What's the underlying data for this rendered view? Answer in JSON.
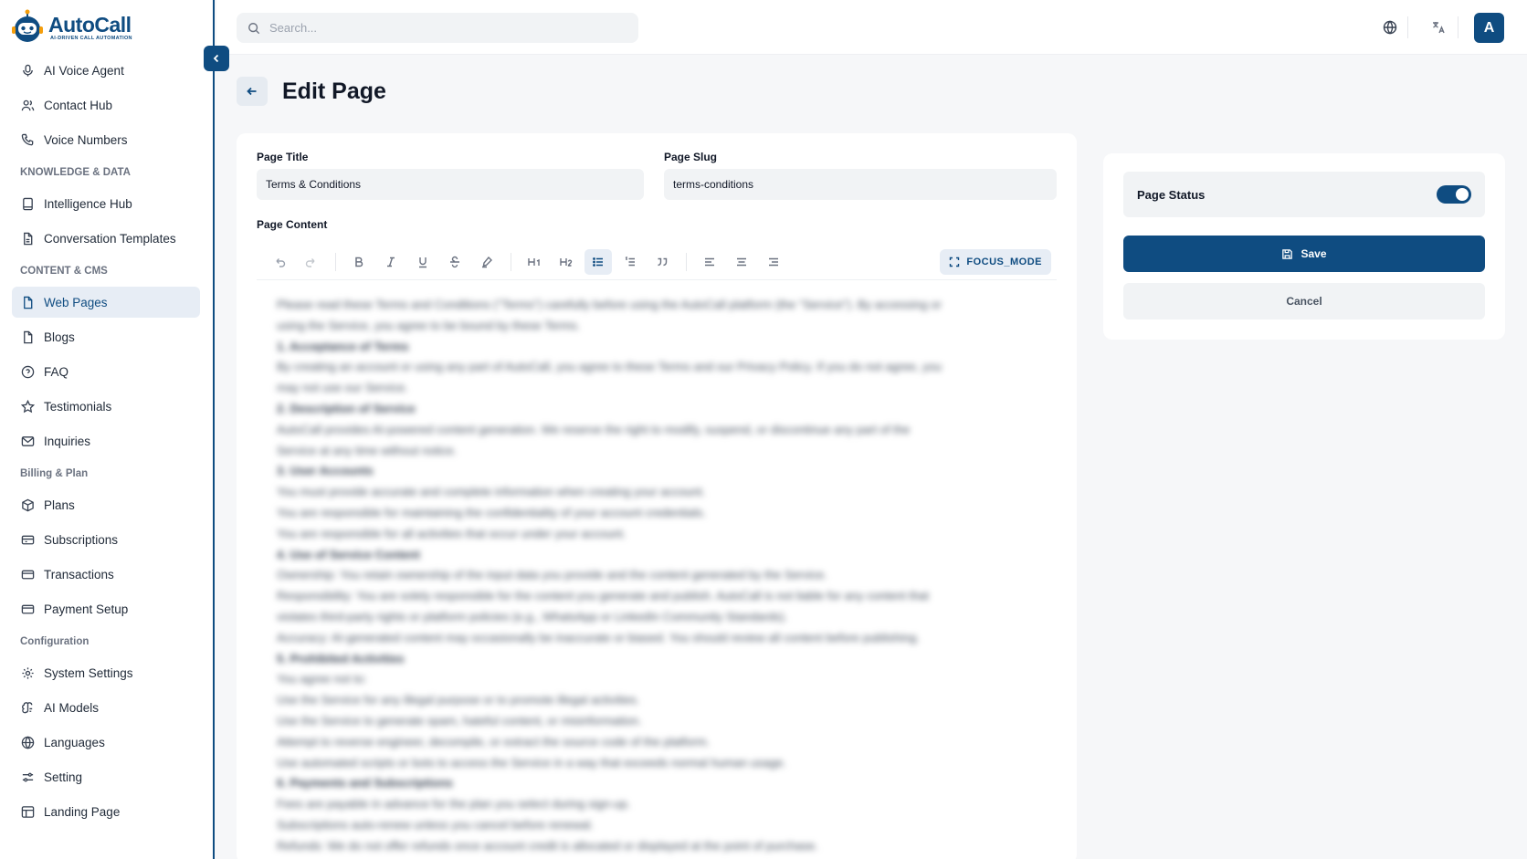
{
  "app": {
    "name": "AutoCall",
    "tagline": "AI-DRIVEN CALL AUTOMATION"
  },
  "sidebar": {
    "items_top": [
      {
        "label": "AI Voice Agent",
        "icon": "mic-icon"
      },
      {
        "label": "Contact Hub",
        "icon": "users-icon"
      },
      {
        "label": "Voice Numbers",
        "icon": "phone-icon"
      }
    ],
    "sections": [
      {
        "title": "KNOWLEDGE & DATA",
        "items": [
          {
            "label": "Intelligence Hub",
            "icon": "book-icon"
          },
          {
            "label": "Conversation Templates",
            "icon": "file-icon"
          }
        ]
      },
      {
        "title": "CONTENT & CMS",
        "items": [
          {
            "label": "Web Pages",
            "icon": "file-icon",
            "active": true
          },
          {
            "label": "Blogs",
            "icon": "file-icon"
          },
          {
            "label": "FAQ",
            "icon": "help-circle-icon"
          },
          {
            "label": "Testimonials",
            "icon": "star-icon"
          },
          {
            "label": "Inquiries",
            "icon": "mail-icon"
          }
        ]
      },
      {
        "title": "Billing & Plan",
        "items": [
          {
            "label": "Plans",
            "icon": "package-icon"
          },
          {
            "label": "Subscriptions",
            "icon": "ticket-icon"
          },
          {
            "label": "Transactions",
            "icon": "credit-card-icon"
          },
          {
            "label": "Payment Setup",
            "icon": "credit-card-icon"
          }
        ]
      },
      {
        "title": "Configuration",
        "items": [
          {
            "label": "System Settings",
            "icon": "gear-icon"
          },
          {
            "label": "AI Models",
            "icon": "brain-icon"
          },
          {
            "label": "Languages",
            "icon": "globe-icon"
          },
          {
            "label": "Setting",
            "icon": "sliders-icon"
          },
          {
            "label": "Landing Page",
            "icon": "layout-icon"
          }
        ]
      }
    ]
  },
  "topbar": {
    "search_placeholder": "Search...",
    "avatar_initial": "A"
  },
  "page": {
    "title": "Edit Page"
  },
  "form": {
    "title_label": "Page Title",
    "title_value": "Terms & Conditions",
    "slug_label": "Page Slug",
    "slug_value": "terms-conditions",
    "content_label": "Page Content",
    "focus_mode_label": "FOCUS_MODE"
  },
  "content_lines": [
    {
      "text": "Please read these Terms and Conditions (\"Terms\") carefully before using the AutoCall platform (the \"Service\"). By accessing or",
      "heading": false
    },
    {
      "text": "using the Service, you agree to be bound by these Terms.",
      "heading": false
    },
    {
      "text": "1. Acceptance of Terms",
      "heading": true
    },
    {
      "text": "By creating an account or using any part of AutoCall, you agree to these Terms and our Privacy Policy. If you do not agree, you",
      "heading": false
    },
    {
      "text": "may not use our Service.",
      "heading": false
    },
    {
      "text": "2. Description of Service",
      "heading": true
    },
    {
      "text": "AutoCall provides AI-powered content generation. We reserve the right to modify, suspend, or discontinue any part of the",
      "heading": false
    },
    {
      "text": "Service at any time without notice.",
      "heading": false
    },
    {
      "text": "3. User Accounts",
      "heading": true
    },
    {
      "text": "You must provide accurate and complete information when creating your account.",
      "heading": false
    },
    {
      "text": "You are responsible for maintaining the confidentiality of your account credentials.",
      "heading": false
    },
    {
      "text": "You are responsible for all activities that occur under your account.",
      "heading": false
    },
    {
      "text": "4. Use of Service Content",
      "heading": true
    },
    {
      "text": "Ownership: You retain ownership of the input data you provide and the content generated by the Service.",
      "heading": false
    },
    {
      "text": "Responsibility: You are solely responsible for the content you generate and publish. AutoCall is not liable for any content that",
      "heading": false
    },
    {
      "text": "violates third-party rights or platform policies (e.g., WhatsApp or LinkedIn Community Standards).",
      "heading": false
    },
    {
      "text": "Accuracy: AI-generated content may occasionally be inaccurate or biased. You should review all content before publishing.",
      "heading": false
    },
    {
      "text": "5. Prohibited Activities",
      "heading": true
    },
    {
      "text": "You agree not to:",
      "heading": false
    },
    {
      "text": "Use the Service for any illegal purpose or to promote illegal activities.",
      "heading": false
    },
    {
      "text": "Use the Service to generate spam, hateful content, or misinformation.",
      "heading": false
    },
    {
      "text": "Attempt to reverse engineer, decompile, or extract the source code of the platform.",
      "heading": false
    },
    {
      "text": "Use automated scripts or bots to access the Service in a way that exceeds normal human usage.",
      "heading": false
    },
    {
      "text": "6. Payments and Subscriptions",
      "heading": true
    },
    {
      "text": "Fees are payable in advance for the plan you select during sign-up.",
      "heading": false
    },
    {
      "text": "Subscriptions auto-renew unless you cancel before renewal.",
      "heading": false
    },
    {
      "text": "Refunds: We do not offer refunds once account credit is allocated or displayed at the point of purchase.",
      "heading": false
    }
  ],
  "status_panel": {
    "status_label": "Page Status",
    "status_on": true,
    "save_label": "Save",
    "cancel_label": "Cancel"
  },
  "colors": {
    "brand": "#0f4c81",
    "background": "#f6f7f9",
    "input_bg": "#f1f3f5"
  }
}
